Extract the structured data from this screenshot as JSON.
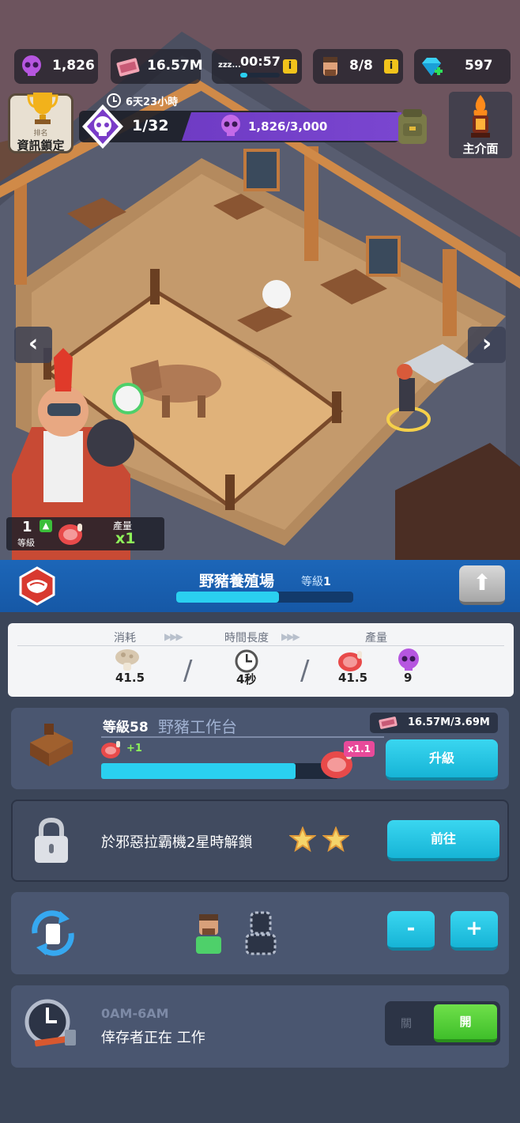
{
  "resources": {
    "skulls": "1,826",
    "cash": "16.57M",
    "sleep_label": "zzz...",
    "sleep_timer": "00:57",
    "survivors": "8/8",
    "gems": "597",
    "info_glyph": "i"
  },
  "trophy": {
    "rank_label": "排名",
    "locked_label": "資訊鎖定"
  },
  "event": {
    "timer": "6天23小時",
    "progress": "1/32",
    "skull_progress": "1,826/3,000"
  },
  "home": {
    "label": "主介面"
  },
  "nav": {
    "left": "‹",
    "right": "›"
  },
  "level_badge": {
    "level": "1",
    "level_label": "等級",
    "output_label": "產量",
    "multiplier": "x1"
  },
  "building": {
    "title": "野豬養殖場",
    "level_label": "等級",
    "level_value": "1",
    "progress": 0.58,
    "upgrade_glyph": "⬆"
  },
  "production": {
    "consume_label": "消耗",
    "duration_label": "時間長度",
    "output_label": "產量",
    "consume_value": "41.5",
    "duration_value": "4秒",
    "output_value": "41.5",
    "skull_value": "9",
    "slash": "/"
  },
  "workstation": {
    "level_text": "等級58",
    "name": "野豬工作台",
    "cost": "16.57M/3.69M",
    "bonus": "+1",
    "multiplier": "x1.1",
    "progress": 0.82,
    "upgrade_label": "升級"
  },
  "locked_slot": {
    "text": "於邪惡拉霸機2星時解鎖",
    "go_label": "前往"
  },
  "workers": {
    "minus": "-",
    "plus": "+"
  },
  "schedule": {
    "time": "0AM-6AM",
    "status": "倖存者正在 工作",
    "off_label": "關",
    "on_label": "開"
  },
  "colors": {
    "accent": "#16b4d6",
    "header": "#1658a6",
    "panel": "#4a5670",
    "green": "#3fbf2a"
  }
}
